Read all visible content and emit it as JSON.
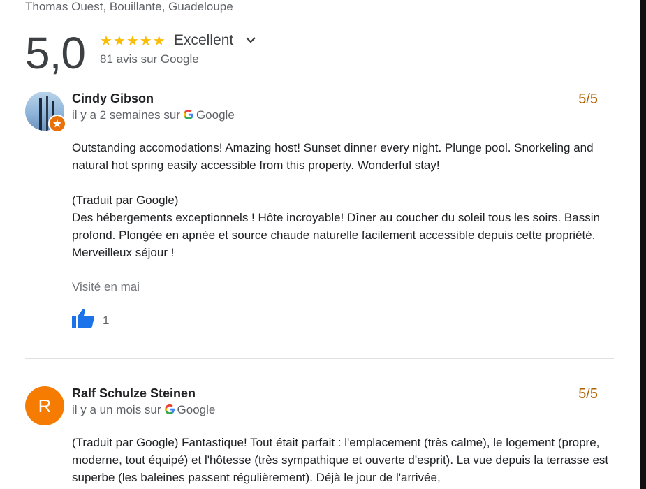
{
  "header": {
    "location": "Thomas Ouest, Bouillante, Guadeloupe",
    "score": "5,0",
    "stars": "★★★★★",
    "rating_word": "Excellent",
    "review_count": "81 avis sur Google"
  },
  "reviews": [
    {
      "name": "Cindy Gibson",
      "meta": "il y a 2 semaines sur",
      "source": "Google",
      "score": "5/5",
      "paragraphs": [
        "Outstanding accomodations! Amazing host! Sunset dinner every night. Plunge pool. Snorkeling and natural hot spring easily accessible from this property. Wonderful stay!",
        "(Traduit par Google)",
        "Des hébergements exceptionnels ! Hôte incroyable! Dîner au coucher du soleil tous les soirs. Bassin profond. Plongée en apnée et source chaude naturelle facilement accessible depuis cette propriété. Merveilleux séjour !"
      ],
      "visited": "Visité en mai",
      "likes": "1"
    },
    {
      "name": "Ralf Schulze Steinen",
      "avatar_letter": "R",
      "meta": "il y a un mois sur",
      "source": "Google",
      "score": "5/5",
      "text": "(Traduit par Google) Fantastique! Tout était parfait : l'emplacement (très calme), le logement (propre, moderne, tout équipé) et l'hôtesse (très sympathique et ouverte d'esprit). La vue depuis la terrasse est superbe (les baleines passent régulièrement). Déjà le jour de l'arrivée,"
    }
  ],
  "colors": {
    "star": "#fbbc04",
    "score_accent": "#b06000",
    "avatar_orange": "#f57c00",
    "like_blue": "#1a73e8"
  }
}
